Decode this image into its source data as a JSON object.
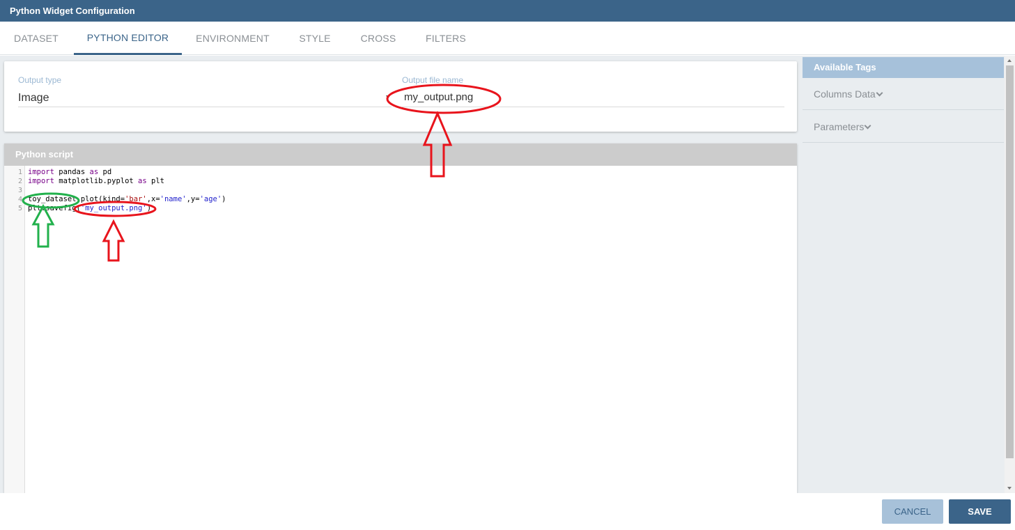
{
  "window": {
    "title": "Python Widget Configuration"
  },
  "tabs": [
    {
      "label": "DATASET"
    },
    {
      "label": "PYTHON EDITOR",
      "active": true
    },
    {
      "label": "ENVIRONMENT"
    },
    {
      "label": "STYLE"
    },
    {
      "label": "CROSS"
    },
    {
      "label": "FILTERS"
    }
  ],
  "output": {
    "type_label": "Output type",
    "type_value": "Image",
    "file_label": "Output file name",
    "file_value": "my_output.png"
  },
  "script": {
    "header": "Python script",
    "line_numbers": [
      "1",
      "2",
      "3",
      "4",
      "5"
    ],
    "lines": {
      "l1": {
        "kw": "import",
        "rest": " pandas ",
        "kw2": "as",
        "rest2": " pd"
      },
      "l2": {
        "kw": "import",
        "rest": " matplotlib.pyplot ",
        "kw2": "as",
        "rest2": " plt"
      },
      "l4": {
        "a": "toy_dataset.plot(kind=",
        "s1": "'bar'",
        "b": ",x=",
        "s2": "'name'",
        "c": ",y=",
        "s3": "'age'",
        "d": ")"
      },
      "l5": {
        "a": "plt.savefig(",
        "s1": "'my_output.png'",
        "b": ")"
      }
    }
  },
  "sidebar": {
    "header": "Available Tags",
    "items": [
      {
        "label": "Columns Data"
      },
      {
        "label": "Parameters"
      }
    ]
  },
  "footer": {
    "cancel_label": "CANCEL",
    "save_label": "SAVE"
  },
  "colors": {
    "primary": "#3b6489",
    "annotation_red": "#e8141c",
    "annotation_green": "#22b14c"
  }
}
